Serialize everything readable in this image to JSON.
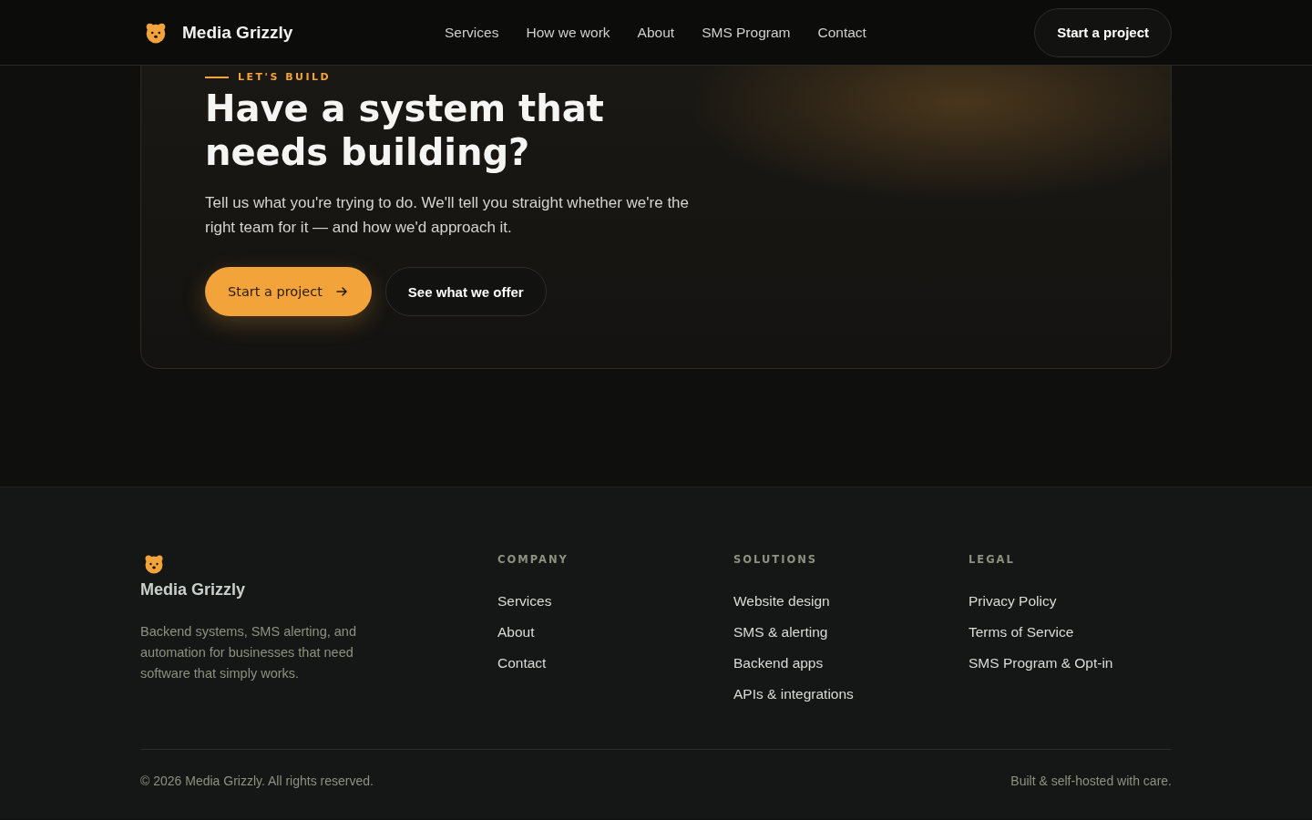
{
  "header": {
    "brand": "Media Grizzly",
    "nav": [
      {
        "label": "Services"
      },
      {
        "label": "How we work"
      },
      {
        "label": "About"
      },
      {
        "label": "SMS Program"
      },
      {
        "label": "Contact"
      }
    ],
    "cta": "Start a project"
  },
  "cta_card": {
    "eyebrow": "LET'S BUILD",
    "title": "Have a system that needs building?",
    "text": "Tell us what you're trying to do. We'll tell you straight whether we're the right team for it — and how we'd approach it.",
    "primary": "Start a project",
    "secondary": "See what we offer"
  },
  "footer": {
    "brand": "Media Grizzly",
    "tagline": "Backend systems, SMS alerting, and automation for businesses that need software that simply works.",
    "columns": [
      {
        "heading": "COMPANY",
        "links": [
          "Services",
          "About",
          "Contact"
        ]
      },
      {
        "heading": "SOLUTIONS",
        "links": [
          "Website design",
          "SMS & alerting",
          "Backend apps",
          "APIs & integrations"
        ]
      },
      {
        "heading": "LEGAL",
        "links": [
          "Privacy Policy",
          "Terms of Service",
          "SMS Program & Opt-in"
        ]
      }
    ],
    "copyright": "© 2026 Media Grizzly. All rights reserved.",
    "note": "Built & self-hosted with care."
  }
}
